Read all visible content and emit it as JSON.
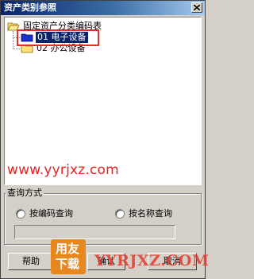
{
  "window": {
    "title": "资产类别参照"
  },
  "tree": {
    "root_label": "固定资产分类编码表",
    "items": [
      {
        "label": "01  电子设备",
        "selected": true
      },
      {
        "label": "02  办公设备",
        "selected": false
      }
    ]
  },
  "watermark": {
    "url": "www.yyrjxz.com",
    "logo_top": "用友",
    "logo_bottom": "下载",
    "text": "YYRJXZ.COM"
  },
  "query": {
    "group_title": "查询方式",
    "options": [
      {
        "label": "按编码查询",
        "selected": false
      },
      {
        "label": "按名称查询",
        "selected": false
      }
    ],
    "input_value": ""
  },
  "buttons": {
    "help": "帮助",
    "confirm": "确认",
    "cancel": "取消"
  },
  "colors": {
    "titlebar": "#0a246a",
    "selection": "#0a246a",
    "highlight_box": "#e0302e",
    "watermark": "#e8201e",
    "logo": "#e8871e"
  }
}
